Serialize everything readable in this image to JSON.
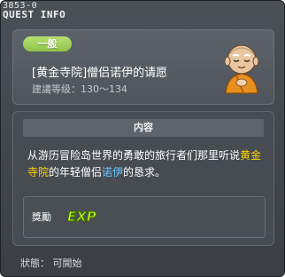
{
  "window": {
    "quest_id": "3853-0",
    "title": "QUEST INFO"
  },
  "quest": {
    "category_badge": "一般",
    "name": "[黄金寺院]僧侣诺伊的请愿",
    "level_range": "建議等级：130～134",
    "npc_icon": "monk-npc-icon"
  },
  "content": {
    "header": "内容",
    "text_parts": [
      "从游历冒险岛世界的勇敢的旅行者们那里听说",
      "黄金寺院",
      "的年轻僧侣",
      "诺伊",
      "的恳求。"
    ]
  },
  "reward": {
    "label": "獎勵",
    "icon": "exp-icon",
    "icon_text": "EXP"
  },
  "status": {
    "text": "狀態： 可開始"
  },
  "colors": {
    "highlight_place": "#ffd400",
    "highlight_npc": "#6ecbff",
    "badge": "#8ec34a"
  }
}
